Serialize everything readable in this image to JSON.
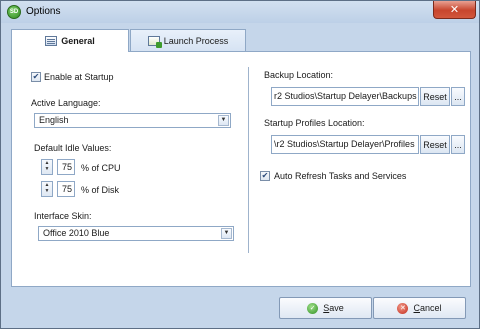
{
  "window": {
    "title": "Options",
    "app_icon_text": "SD",
    "close_glyph": "✕"
  },
  "tabs": [
    {
      "label": "General",
      "selected": true
    },
    {
      "label": "Launch Process",
      "selected": false
    }
  ],
  "general": {
    "enable_startup": {
      "label": "Enable at Startup",
      "checked": true
    },
    "language": {
      "label": "Active Language:",
      "value": "English"
    },
    "idle": {
      "label": "Default Idle Values:",
      "cpu": {
        "value": "75",
        "unit": "% of CPU"
      },
      "disk": {
        "value": "75",
        "unit": "% of Disk"
      }
    },
    "skin": {
      "label": "Interface Skin:",
      "value": "Office 2010 Blue"
    },
    "backup": {
      "label": "Backup Location:",
      "path": "r2 Studios\\Startup Delayer\\Backups",
      "reset": "Reset",
      "browse": "..."
    },
    "profiles": {
      "label": "Startup Profiles Location:",
      "path": "\\r2 Studios\\Startup Delayer\\Profiles",
      "reset": "Reset",
      "browse": "..."
    },
    "auto_refresh": {
      "label": "Auto Refresh Tasks and Services",
      "checked": true
    }
  },
  "footer": {
    "save_first": "S",
    "save_rest": "ave",
    "cancel_first": "C",
    "cancel_rest": "ancel"
  }
}
